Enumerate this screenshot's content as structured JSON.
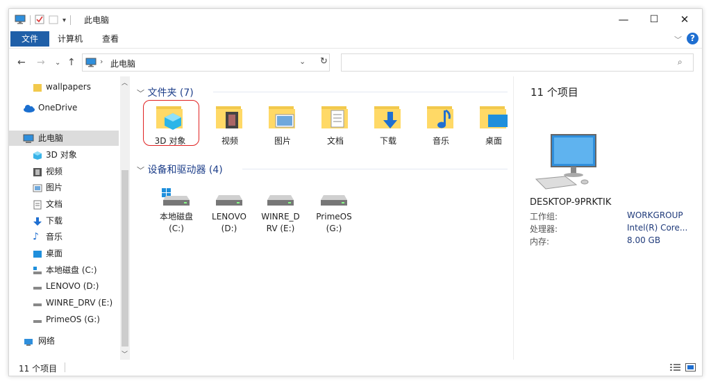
{
  "window": {
    "title": "此电脑",
    "controls": [
      "—",
      "☐",
      "✕"
    ]
  },
  "ribbon": {
    "tabs": [
      "文件",
      "计算机",
      "查看"
    ],
    "help_icon": "?",
    "collapse_icon": "chevron-down-icon"
  },
  "address": {
    "path": "此电脑",
    "search_placeholder": ""
  },
  "sidebar": {
    "items": [
      {
        "label": "wallpapers",
        "icon": "folder-icon"
      },
      {
        "label": "OneDrive",
        "icon": "cloud-icon"
      },
      {
        "label": "此电脑",
        "icon": "computer-icon",
        "selected": true
      },
      {
        "label": "3D 对象",
        "icon": "3d-objects-icon"
      },
      {
        "label": "视频",
        "icon": "video-icon"
      },
      {
        "label": "图片",
        "icon": "pictures-icon"
      },
      {
        "label": "文档",
        "icon": "documents-icon"
      },
      {
        "label": "下载",
        "icon": "download-icon"
      },
      {
        "label": "音乐",
        "icon": "music-icon"
      },
      {
        "label": "桌面",
        "icon": "desktop-icon"
      },
      {
        "label": "本地磁盘 (C:)",
        "icon": "system-drive-icon"
      },
      {
        "label": "LENOVO (D:)",
        "icon": "drive-icon"
      },
      {
        "label": "WINRE_DRV (E:)",
        "icon": "drive-icon"
      },
      {
        "label": "PrimeOS (G:)",
        "icon": "drive-icon"
      },
      {
        "label": "网络",
        "icon": "network-icon"
      }
    ]
  },
  "content": {
    "folders_header": "文件夹 (7)",
    "folders": [
      {
        "label": "3D 对象",
        "icon": "3d-objects-icon",
        "highlighted": true
      },
      {
        "label": "视频",
        "icon": "video-icon"
      },
      {
        "label": "图片",
        "icon": "pictures-icon"
      },
      {
        "label": "文档",
        "icon": "documents-icon"
      },
      {
        "label": "下载",
        "icon": "download-icon"
      },
      {
        "label": "音乐",
        "icon": "music-icon"
      },
      {
        "label": "桌面",
        "icon": "desktop-icon"
      }
    ],
    "drives_header": "设备和驱动器 (4)",
    "drives": [
      {
        "line1": "本地磁盘",
        "line2": "(C:)",
        "icon": "system-drive-icon"
      },
      {
        "line1": "LENOVO",
        "line2": "(D:)",
        "icon": "drive-icon"
      },
      {
        "line1": "WINRE_D",
        "line2": "RV (E:)",
        "icon": "drive-icon"
      },
      {
        "line1": "PrimeOS",
        "line2": "(G:)",
        "icon": "drive-icon"
      }
    ]
  },
  "details": {
    "count": "11 个项目",
    "computer_name": "DESKTOP-9PRKTIK",
    "rows": [
      {
        "label": "工作组:",
        "value": "WORKGROUP"
      },
      {
        "label": "处理器:",
        "value": "Intel(R) Core..."
      },
      {
        "label": "内存:",
        "value": "8.00 GB"
      }
    ]
  },
  "status": {
    "count": "11 个项目"
  },
  "colors": {
    "accent": "#1f5fa8",
    "header_text": "#1e3f8a",
    "highlight_ring": "#e02020",
    "folder": "#f2c94c"
  }
}
